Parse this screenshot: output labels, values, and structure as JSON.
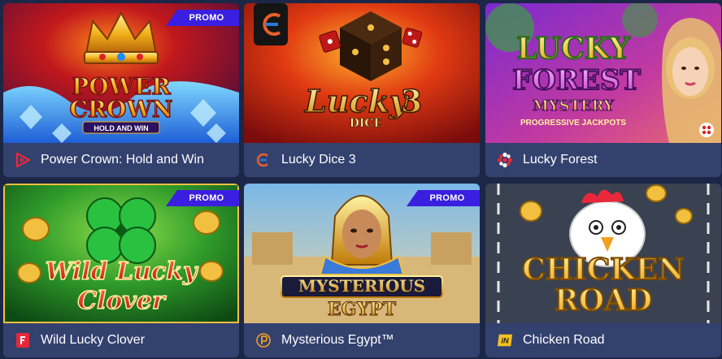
{
  "colors": {
    "page_bg": "#1c2748",
    "card_footer": "#33416f",
    "promo_badge": "#3a1fe0"
  },
  "games": [
    {
      "name": "Power Crown: Hold and Win",
      "promo": "PROMO",
      "provider_icon": "play-triangle-logo-icon",
      "art_lines": [
        "POWER",
        "CROWN",
        "HOLD AND WIN"
      ]
    },
    {
      "name": "Lucky Dice 3",
      "provider_icon": "endorphina-e-logo-icon",
      "art_lines": [
        "Lucky",
        "3",
        "DICE"
      ]
    },
    {
      "name": "Lucky Forest",
      "provider_icon": "dots-cluster-logo-icon",
      "art_lines": [
        "LUCKY",
        "FOREST",
        "MYSTERY",
        "PROGRESSIVE JACKPOTS"
      ]
    },
    {
      "name": "Wild Lucky Clover",
      "promo": "PROMO",
      "provider_icon": "f-square-logo-icon",
      "art_lines": [
        "Wild Lucky",
        "Clover"
      ]
    },
    {
      "name": "Mysterious Egypt™",
      "promo": "PROMO",
      "provider_icon": "pragmatic-play-logo-icon",
      "art_lines": [
        "MYSTERIOUS",
        "EGYPT"
      ]
    },
    {
      "name": "Chicken Road",
      "provider_icon": "in-out-logo-icon",
      "art_lines": [
        "CHICKEN",
        "ROAD"
      ]
    }
  ]
}
